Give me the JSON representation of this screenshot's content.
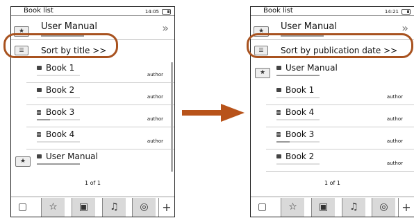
{
  "left": {
    "title": "Book list",
    "time": "14:05",
    "pinned": {
      "name": "User Manual",
      "chevron": "»"
    },
    "sort_label": "Sort by title >>",
    "books": [
      {
        "name": "Book 1",
        "author": "author",
        "progress": 0
      },
      {
        "name": "Book 2",
        "author": "author",
        "progress": 0
      },
      {
        "name": "Book 3",
        "author": "author",
        "progress": 0.3
      },
      {
        "name": "Book 4",
        "author": "author",
        "progress": 0
      },
      {
        "name": "User Manual",
        "author": "",
        "progress": 1
      }
    ],
    "pager": "1 of 1"
  },
  "right": {
    "title": "Book list",
    "time": "14:21",
    "pinned": {
      "name": "User Manual",
      "chevron": "»"
    },
    "sort_label": "Sort by publication date >>",
    "books": [
      {
        "name": "User Manual",
        "author": "",
        "progress": 1
      },
      {
        "name": "Book 1",
        "author": "author",
        "progress": 0
      },
      {
        "name": "Book 4",
        "author": "author",
        "progress": 0
      },
      {
        "name": "Book 3",
        "author": "author",
        "progress": 0.3
      },
      {
        "name": "Book 2",
        "author": "author",
        "progress": 0
      }
    ],
    "pager": "1 of 1"
  },
  "tabs": {
    "library": "▢",
    "favorites": "☆",
    "images": "▣",
    "music": "♫",
    "web": "◎",
    "more": "+"
  },
  "colors": {
    "highlight_oval": "#a8521f",
    "arrow": "#b8531a"
  }
}
